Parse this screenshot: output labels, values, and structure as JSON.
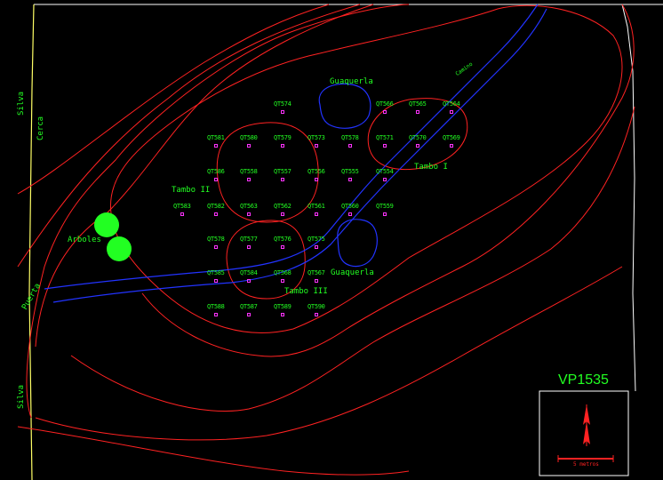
{
  "map_id": "VP1535",
  "labels": {
    "silva_top": "Silva",
    "cerca": "Cerca",
    "silva_bottom": "Silva",
    "puerta": "Puerta",
    "arboles": "Arboles",
    "guaquerla_top": "Guaquerla",
    "guaquerla_bottom": "Guaquerla",
    "tambo_1": "Tambo I",
    "tambo_2": "Tambo II",
    "tambo_3": "Tambo III",
    "camino": "Camino",
    "scale": "5 metros"
  },
  "grid_points": [
    "QT574",
    "QT566",
    "QT565",
    "QT564",
    "QT581",
    "QT580",
    "QT579",
    "QT573",
    "QT578",
    "QT571",
    "QT570",
    "QT569",
    "QT586",
    "QT558",
    "QT557",
    "QT556",
    "QT555",
    "QT554",
    "QT583",
    "QT582",
    "QT563",
    "QT562",
    "QT561",
    "QT560",
    "QT559",
    "QT578",
    "QT577",
    "QT576",
    "QT575",
    "QT585",
    "QT584",
    "QT568",
    "QT567",
    "QT588",
    "QT587",
    "QT589",
    "QT590"
  ],
  "colors": {
    "contour": "#ff2222",
    "water": "#2233ff",
    "label": "#22ff22",
    "marker": "#ff33ff",
    "border": "#ffffff",
    "fence": "#ffff66"
  }
}
